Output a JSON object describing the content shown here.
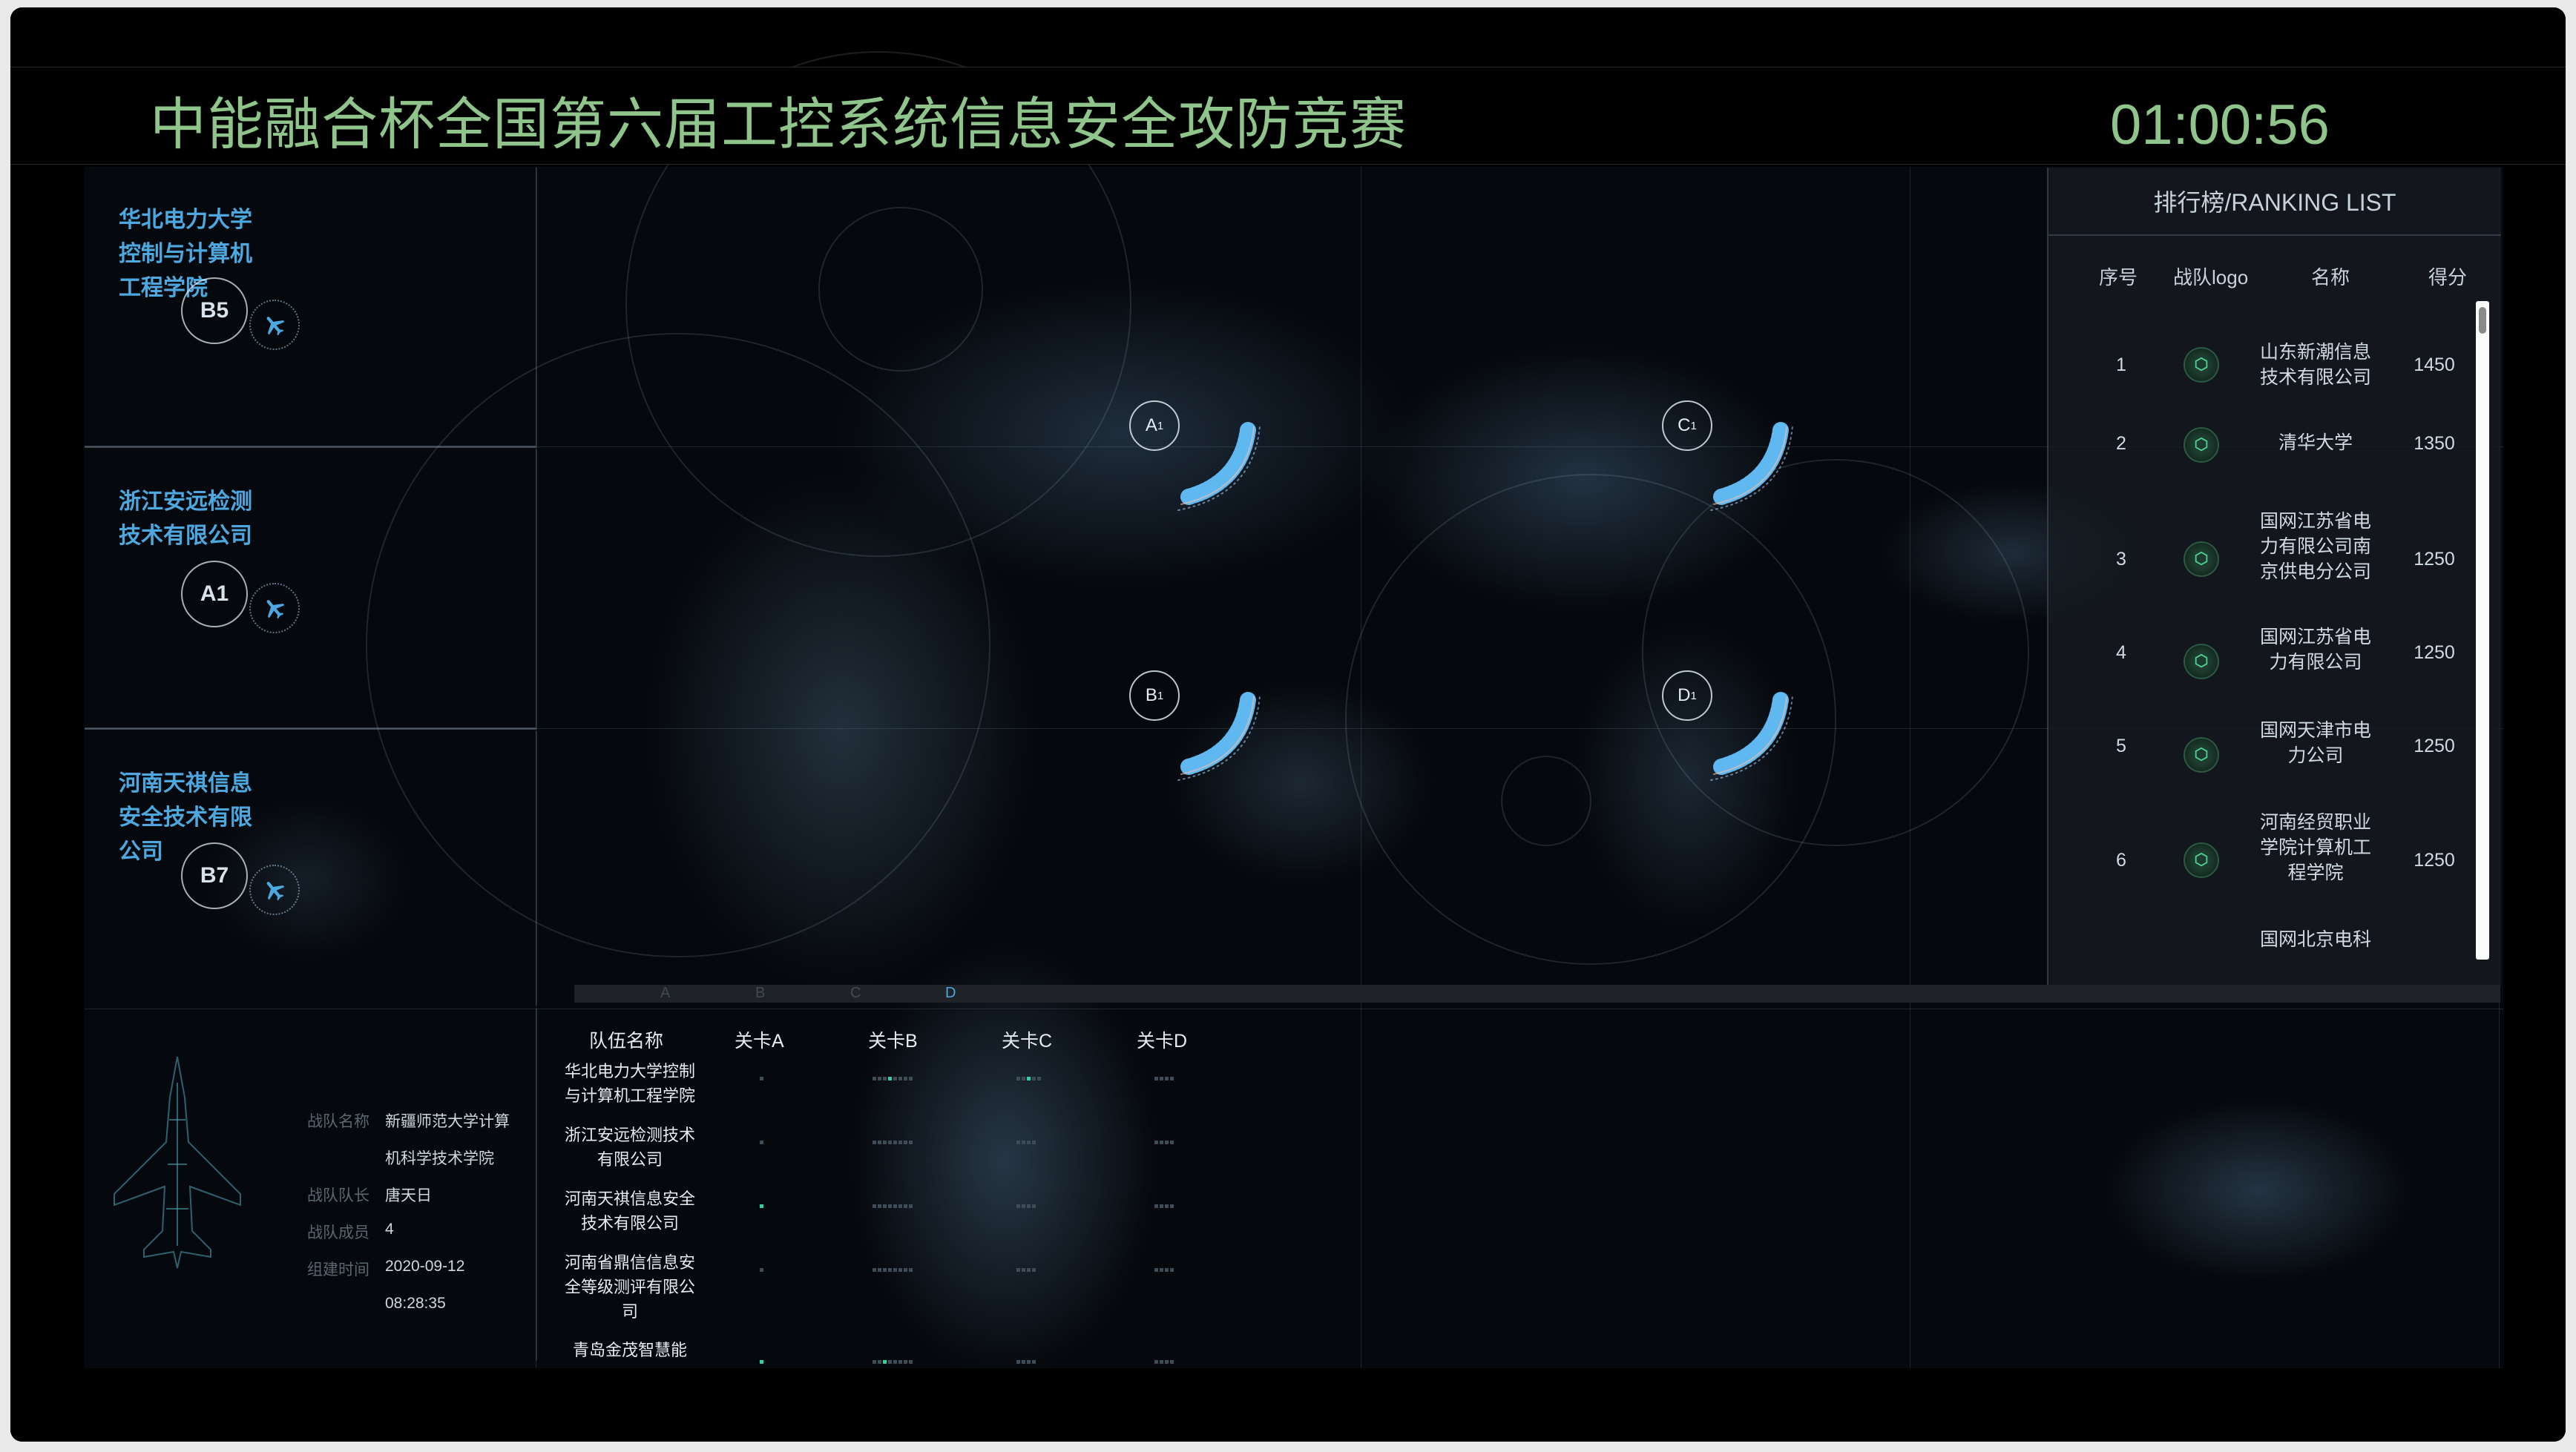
{
  "header": {
    "title": "中能融合杯全国第六届工控系统信息安全攻防竞赛",
    "timer": "01:00:56"
  },
  "team_cards": [
    {
      "name": "华北电力大学控制与计算机工程学院",
      "code": "B5"
    },
    {
      "name": "浙江安远检测技术有限公司",
      "code": "A1"
    },
    {
      "name": "河南天祺信息安全技术有限公司",
      "code": "B7"
    }
  ],
  "map_markers": [
    {
      "letter": "A",
      "sub": "1"
    },
    {
      "letter": "C",
      "sub": "1"
    },
    {
      "letter": "B",
      "sub": "1"
    },
    {
      "letter": "D",
      "sub": "1"
    }
  ],
  "ranking": {
    "title": "排行榜/RANKING LIST",
    "columns": [
      "序号",
      "战队logo",
      "名称",
      "得分"
    ],
    "rows": [
      {
        "no": "1",
        "name": "山东新潮信息技术有限公司",
        "score": "1450"
      },
      {
        "no": "2",
        "name": "清华大学",
        "score": "1350"
      },
      {
        "no": "3",
        "name": "国网江苏省电力有限公司南京供电分公司",
        "score": "1250"
      },
      {
        "no": "4",
        "name": "国网江苏省电力有限公司",
        "score": "1250"
      },
      {
        "no": "5",
        "name": "国网天津市电力公司",
        "score": "1250"
      },
      {
        "no": "6",
        "name": "河南经贸职业学院计算机工程学院",
        "score": "1250"
      },
      {
        "no": "",
        "name": "国网北京电科",
        "score": ""
      }
    ]
  },
  "level_tabs": [
    "A",
    "B",
    "C",
    "D"
  ],
  "level_tab_active": "D",
  "team_info": {
    "labels": {
      "name": "战队名称",
      "captain": "战队队长",
      "members": "战队成员",
      "created": "组建时间"
    },
    "values": {
      "name_line1": "新疆师范大学计算",
      "name_line2": "机科学技术学院",
      "captain": "唐天日",
      "members": "4",
      "created_date": "2020-09-12",
      "created_time": "08:28:35"
    }
  },
  "progress_table": {
    "columns": [
      "队伍名称",
      "关卡A",
      "关卡B",
      "关卡C",
      "关卡D"
    ],
    "rows": [
      {
        "team": "华北电力大学控制与计算机工程学院",
        "a": [
          0
        ],
        "b": [
          0,
          0,
          0,
          1,
          0,
          0,
          0,
          0
        ],
        "c": [
          0,
          0,
          1,
          0,
          0
        ],
        "d": [
          0,
          0,
          0,
          0
        ]
      },
      {
        "team": "浙江安远检测技术有限公司",
        "a": [
          0
        ],
        "b": [
          0,
          0,
          0,
          0,
          0,
          0,
          0,
          0
        ],
        "c": [
          0,
          0,
          0,
          0
        ],
        "d": [
          0,
          0,
          0,
          0
        ]
      },
      {
        "team": "河南天祺信息安全技术有限公司",
        "a": [
          1
        ],
        "b": [
          0,
          0,
          0,
          0,
          0,
          0,
          0,
          0
        ],
        "c": [
          0,
          0,
          0,
          0
        ],
        "d": [
          0,
          0,
          0,
          0
        ]
      },
      {
        "team": "河南省鼎信信息安全等级测评有限公司",
        "a": [
          0
        ],
        "b": [
          0,
          0,
          0,
          0,
          0,
          0,
          0,
          0
        ],
        "c": [
          0,
          0,
          0,
          0
        ],
        "d": [
          0,
          0,
          0,
          0
        ]
      },
      {
        "team": "青岛金茂智慧能",
        "a": [
          1
        ],
        "b": [
          0,
          0,
          1,
          0,
          0,
          0,
          0,
          0
        ],
        "c": [
          0,
          0,
          0,
          0
        ],
        "d": [
          0,
          0,
          0,
          0
        ]
      }
    ]
  },
  "colors": {
    "title": "#8fc48a",
    "team_name": "#4ea8e0",
    "active_tab": "#4ea8e0",
    "progress_on": "#2fd3a0"
  }
}
